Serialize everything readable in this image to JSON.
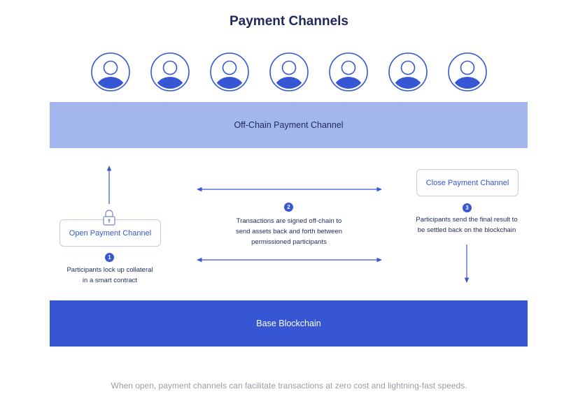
{
  "title": "Payment Channels",
  "participants": {
    "count": 7,
    "icon": "user-avatar-icon",
    "ring_color": "#3656d4",
    "fill_color": "#3656d4"
  },
  "offchain_band": {
    "label": "Off-Chain Payment Channel",
    "color": "#a3b6ee"
  },
  "base_band": {
    "label": "Base Blockchain",
    "color": "#3656d4"
  },
  "steps": {
    "open": {
      "number": "1",
      "label": "Open Payment Channel",
      "description_line1": "Participants lock up collateral",
      "description_line2": "in a smart contract",
      "icon": "padlock-icon"
    },
    "transact": {
      "number": "2",
      "description_line1": "Transactions are signed off-chain to",
      "description_line2": "send assets back and forth between",
      "description_line3": "permissioned participants"
    },
    "close": {
      "number": "3",
      "label": "Close Payment Channel",
      "description_line1": "Participants send the final result to",
      "description_line2": "be settled back on the blockchain"
    }
  },
  "caption": "When open, payment channels can facilitate transactions at zero cost and lightning-fast speeds."
}
